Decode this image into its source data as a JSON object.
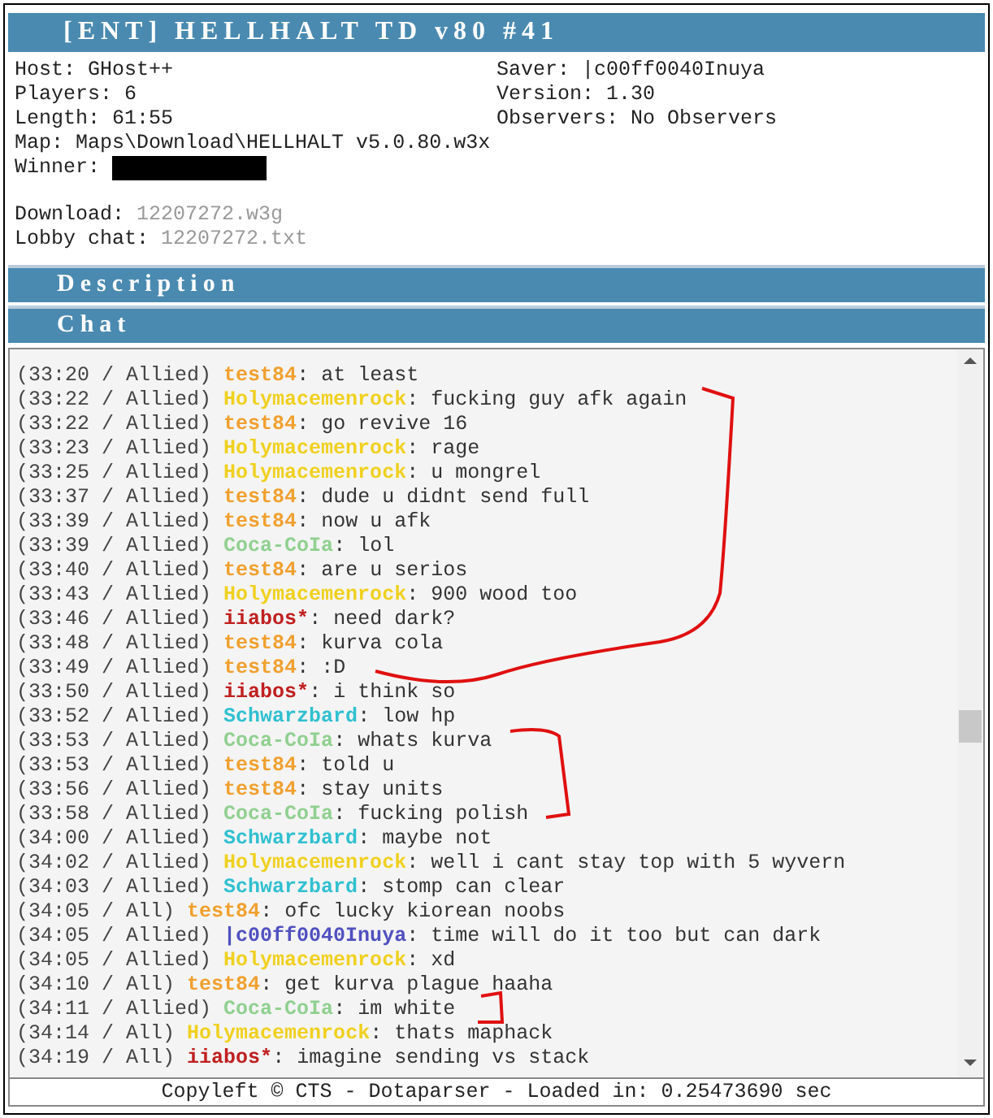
{
  "title": "[ENT] HELLHALT TD v80 #41",
  "info_left": [
    {
      "label": "Host:",
      "value": "GHost++"
    },
    {
      "label": "Players:",
      "value": "6"
    },
    {
      "label": "Length:",
      "value": "61:55"
    }
  ],
  "info_right": [
    {
      "label": "Saver:",
      "value": "|c00ff0040Inuya"
    },
    {
      "label": "Version:",
      "value": "1.30"
    },
    {
      "label": "Observers:",
      "value": "No Observers"
    }
  ],
  "map": {
    "label": "Map:",
    "value": "Maps\\Download\\HELLHALT v5.0.80.w3x"
  },
  "winner": {
    "label": "Winner:"
  },
  "links": [
    {
      "label": "Download:",
      "value": "12207272.w3g"
    },
    {
      "label": "Lobby chat:",
      "value": "12207272.txt"
    }
  ],
  "sections": [
    "Description",
    "Chat"
  ],
  "chat": [
    {
      "time": "(33:20 / Allied)",
      "player": "test84",
      "color": "#f0a030",
      "text": ": at least"
    },
    {
      "time": "(33:22 / Allied)",
      "player": "Holymacemenrock",
      "color": "#f0d020",
      "text": ": fucking guy afk again"
    },
    {
      "time": "(33:22 / Allied)",
      "player": "test84",
      "color": "#f0a030",
      "text": ": go revive 16"
    },
    {
      "time": "(33:23 / Allied)",
      "player": "Holymacemenrock",
      "color": "#f0d020",
      "text": ": rage"
    },
    {
      "time": "(33:25 / Allied)",
      "player": "Holymacemenrock",
      "color": "#f0d020",
      "text": ": u mongrel"
    },
    {
      "time": "(33:37 / Allied)",
      "player": "test84",
      "color": "#f0a030",
      "text": ": dude u didnt send full"
    },
    {
      "time": "(33:39 / Allied)",
      "player": "test84",
      "color": "#f0a030",
      "text": ": now u afk"
    },
    {
      "time": "(33:39 / Allied)",
      "player": "Coca-CoIa",
      "color": "#90d090",
      "text": ": lol"
    },
    {
      "time": "(33:40 / Allied)",
      "player": "test84",
      "color": "#f0a030",
      "text": ": are u serios"
    },
    {
      "time": "(33:43 / Allied)",
      "player": "Holymacemenrock",
      "color": "#f0d020",
      "text": ": 900 wood too"
    },
    {
      "time": "(33:46 / Allied)",
      "player": "iiabos*",
      "color": "#c02020",
      "text": ": need dark?"
    },
    {
      "time": "(33:48 / Allied)",
      "player": "test84",
      "color": "#f0a030",
      "text": ": kurva cola"
    },
    {
      "time": "(33:49 / Allied)",
      "player": "test84",
      "color": "#f0a030",
      "text": ": :D"
    },
    {
      "time": "(33:50 / Allied)",
      "player": "iiabos*",
      "color": "#c02020",
      "text": ": i think so"
    },
    {
      "time": "(33:52 / Allied)",
      "player": "Schwarzbard",
      "color": "#30c0d0",
      "text": ": low hp"
    },
    {
      "time": "(33:53 / Allied)",
      "player": "Coca-CoIa",
      "color": "#90d090",
      "text": ": whats kurva"
    },
    {
      "time": "(33:53 / Allied)",
      "player": "test84",
      "color": "#f0a030",
      "text": ": told u"
    },
    {
      "time": "(33:56 / Allied)",
      "player": "test84",
      "color": "#f0a030",
      "text": ": stay units"
    },
    {
      "time": "(33:58 / Allied)",
      "player": "Coca-CoIa",
      "color": "#90d090",
      "text": ": fucking polish"
    },
    {
      "time": "(34:00 / Allied)",
      "player": "Schwarzbard",
      "color": "#30c0d0",
      "text": ": maybe not"
    },
    {
      "time": "(34:02 / Allied)",
      "player": "Holymacemenrock",
      "color": "#f0d020",
      "text": ": well i cant stay top with 5 wyvern"
    },
    {
      "time": "(34:03 / Allied)",
      "player": "Schwarzbard",
      "color": "#30c0d0",
      "text": ": stomp can clear"
    },
    {
      "time": "(34:05 / All)",
      "player": "test84",
      "color": "#f0a030",
      "text": ": ofc lucky kiorean noobs"
    },
    {
      "time": "(34:05 / Allied)",
      "player": "|c00ff0040Inuya",
      "color": "#5050c0",
      "text": ": time will do it too but can dark"
    },
    {
      "time": "(34:05 / Allied)",
      "player": "Holymacemenrock",
      "color": "#f0d020",
      "text": ": xd"
    },
    {
      "time": "(34:10 / All)",
      "player": "test84",
      "color": "#f0a030",
      "text": ": get kurva plague haaha"
    },
    {
      "time": "(34:11 / Allied)",
      "player": "Coca-CoIa",
      "color": "#90d090",
      "text": ": im white"
    },
    {
      "time": "(34:14 / All)",
      "player": "Holymacemenrock",
      "color": "#f0d020",
      "text": ": thats maphack"
    },
    {
      "time": "(34:19 / All)",
      "player": "iiabos*",
      "color": "#c02020",
      "text": ": imagine sending vs stack"
    }
  ],
  "footer": "Copyleft © CTS - Dotaparser - Loaded in: 0.25473690 sec"
}
